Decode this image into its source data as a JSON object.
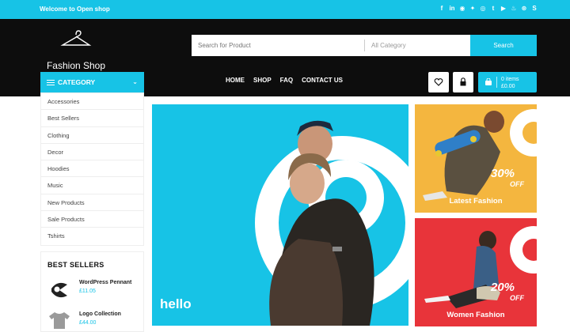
{
  "topbar": {
    "welcome": "Welcome to Open shop",
    "social_icons": [
      "facebook-icon",
      "linkedin-icon",
      "pinterest-icon",
      "twitter-icon",
      "instagram-icon",
      "tumblr-icon",
      "youtube-icon",
      "stumbleupon-icon",
      "dribbble-icon",
      "skype-icon"
    ]
  },
  "header": {
    "logo_text": "Fashion Shop",
    "search": {
      "placeholder": "Search for Product",
      "category": "All Category",
      "button": "Search"
    },
    "category_button": "CATEGORY",
    "nav": [
      "HOME",
      "SHOP",
      "FAQ",
      "CONTACT US"
    ],
    "cart": {
      "items": "0 items",
      "total": "£0.00"
    }
  },
  "sidebar": {
    "categories": [
      "Accessories",
      "Best Sellers",
      "Clothing",
      "Decor",
      "Hoodies",
      "Music",
      "New Products",
      "Sale Products",
      "Tshirts"
    ],
    "best_sellers": {
      "title": "BEST SELLERS",
      "products": [
        {
          "name": "WordPress Pennant",
          "price": "£11.05"
        },
        {
          "name": "Logo Collection",
          "price": "£44.00"
        }
      ]
    }
  },
  "hero": {
    "caption": "hello"
  },
  "banners": [
    {
      "percent": "30%",
      "off": "OFF",
      "label": "Latest Fashion"
    },
    {
      "percent": "20%",
      "off": "OFF",
      "label": "Women Fashion"
    }
  ],
  "colors": {
    "accent": "#17c3e6",
    "header_bg": "#0d0d0d",
    "banner_yellow": "#f4b63f",
    "banner_red": "#e8343a"
  }
}
